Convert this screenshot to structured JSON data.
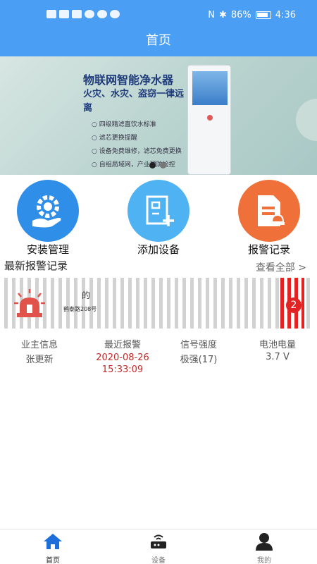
{
  "status_bar": {
    "battery": "86%",
    "time": "4:36"
  },
  "header": {
    "title": "首页"
  },
  "banner": {
    "title": "物联网智能净水器",
    "subtitle": "火灾、水灾、盗窃一律远离",
    "points": [
      "四级精滤直饮水标准",
      "滤芯更换提醒",
      "设备免费维修，滤芯免费更换",
      "自组局域网，产业预防检控"
    ],
    "slide_count": 2,
    "active_slide": 1
  },
  "functions": [
    {
      "label": "安装管理",
      "icon": "gear-hand-icon",
      "color": "#2f8ee8"
    },
    {
      "label": "添加设备",
      "icon": "add-device-icon",
      "color": "#4fb2f2"
    },
    {
      "label": "报警记录",
      "icon": "alarm-doc-icon",
      "color": "#f07039"
    }
  ],
  "alarm_section": {
    "title": "最新报警记录",
    "view_all": "查看全部 >"
  },
  "alarm_card": {
    "owner": "的",
    "address": "鹤泰路208号",
    "badge_count": "2"
  },
  "stats": [
    {
      "key": "业主信息",
      "value": "张更新"
    },
    {
      "key": "最近报警",
      "value": "2020-08-26 15:33:09"
    },
    {
      "key": "信号强度",
      "value": "极强(17)"
    },
    {
      "key": "电池电量",
      "value": "3.7 V"
    }
  ],
  "tabbar": {
    "items": [
      {
        "label": "首页",
        "icon": "home-icon",
        "active": true
      },
      {
        "label": "设备",
        "icon": "router-icon",
        "active": false
      },
      {
        "label": "我的",
        "icon": "user-icon",
        "active": false
      }
    ]
  },
  "colors": {
    "primary": "#4a9ff5",
    "alarm_red": "#e02424",
    "date_red": "#c62828"
  }
}
